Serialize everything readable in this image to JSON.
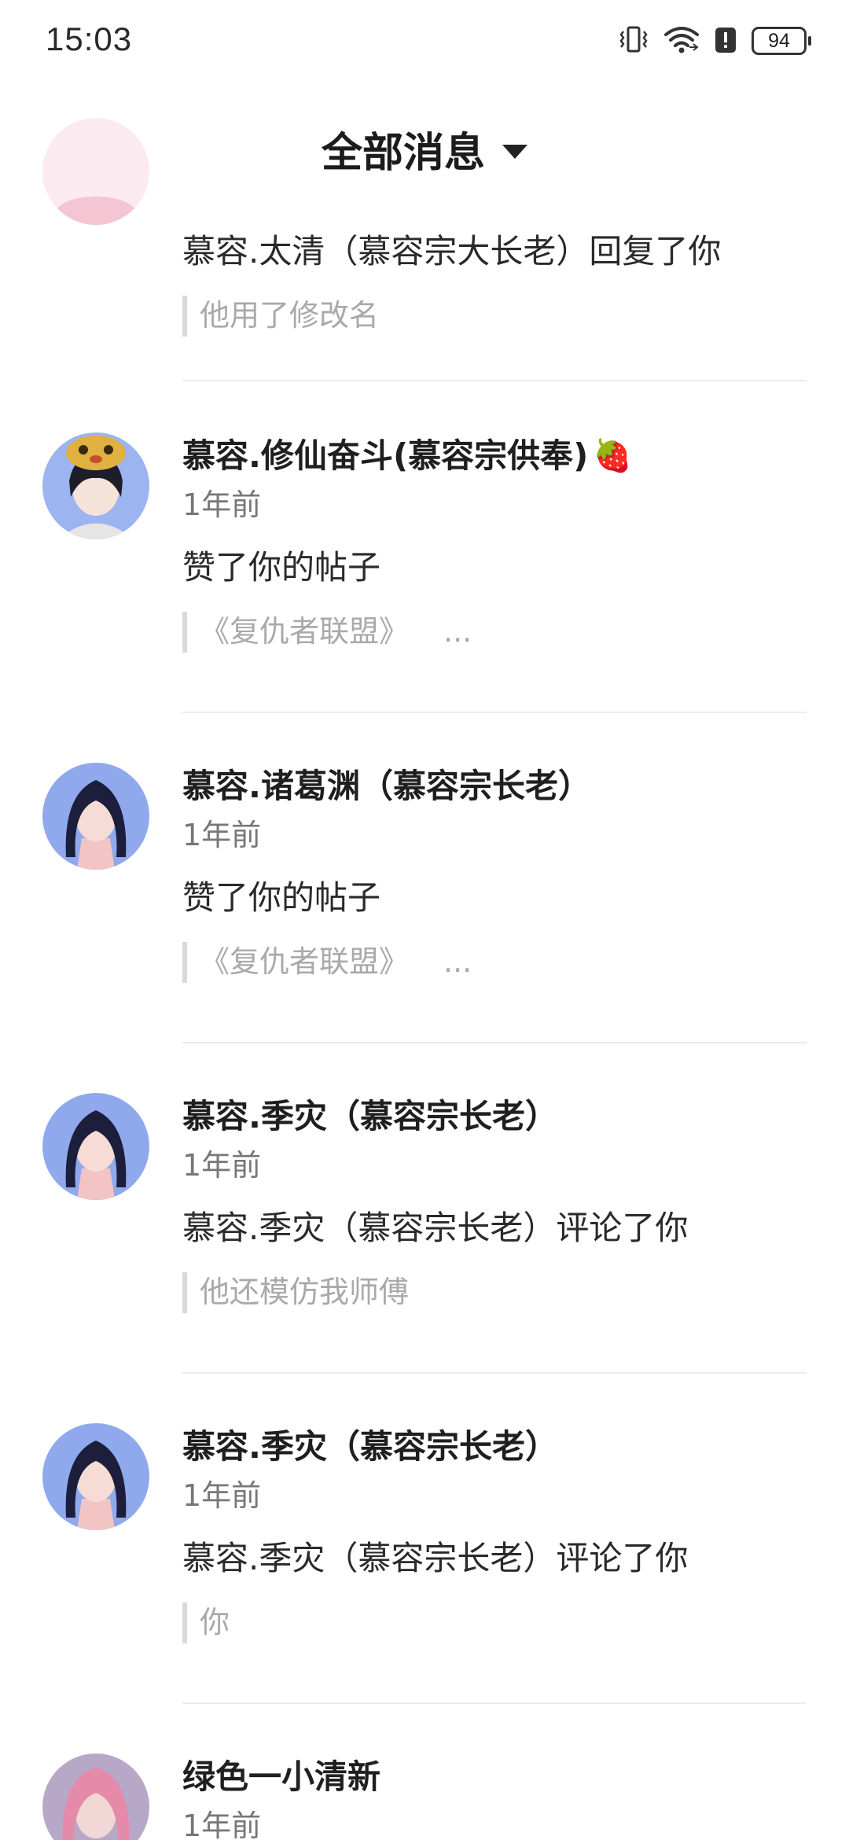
{
  "status_bar": {
    "time": "15:03",
    "battery_level": "94",
    "icons": [
      "vibrate-icon",
      "wifi-icon",
      "alert-icon",
      "battery-icon"
    ]
  },
  "header": {
    "back_icon": "chevron-left-icon",
    "title": "全部消息",
    "dropdown_icon": "caret-down-icon"
  },
  "messages": [
    {
      "name": "",
      "time": "",
      "action": "慕容.太清（慕容宗大长老）回复了你",
      "quote": "他用了修改名",
      "avatar": "avatar-pink"
    },
    {
      "name": "慕容.修仙奋斗(慕容宗供奉)",
      "name_emoji": "🍓",
      "time": "1年前",
      "action": "赞了你的帖子",
      "quote": "《复仇者联盟》",
      "quote_suffix": "...",
      "avatar": "avatar-cat-hat"
    },
    {
      "name": "慕容.诸葛渊（慕容宗长老）",
      "time": "1年前",
      "action": "赞了你的帖子",
      "quote": "《复仇者联盟》",
      "quote_suffix": "...",
      "avatar": "avatar-dark-hair"
    },
    {
      "name": "慕容.季灾（慕容宗长老）",
      "time": "1年前",
      "action": "慕容.季灾（慕容宗长老）评论了你",
      "quote": "他还模仿我师傅",
      "avatar": "avatar-dark-hair"
    },
    {
      "name": "慕容.季灾（慕容宗长老）",
      "time": "1年前",
      "action": "慕容.季灾（慕容宗长老）评论了你",
      "quote": "你",
      "avatar": "avatar-dark-hair"
    },
    {
      "name": "绿色一小清新",
      "time": "1年前",
      "avatar": "avatar-pink-hair"
    }
  ]
}
